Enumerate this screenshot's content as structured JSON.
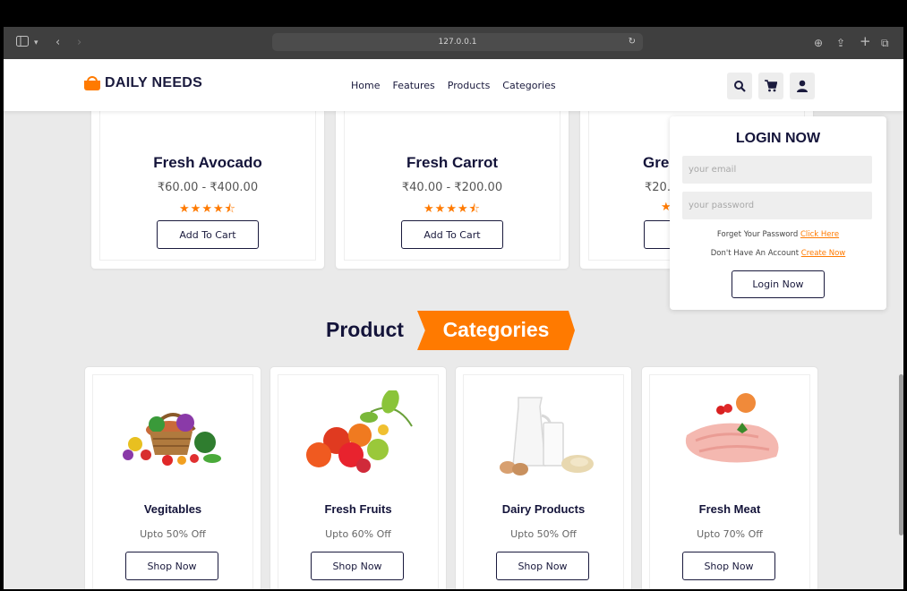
{
  "browser": {
    "url": "127.0.0.1",
    "icons": [
      "sidebar-icon",
      "chevron-down-icon",
      "back-icon",
      "forward-icon",
      "reload-icon",
      "download-icon",
      "share-icon",
      "new-tab-icon",
      "tabs-icon"
    ]
  },
  "header": {
    "logo_text": "DAILY NEEDS",
    "nav": [
      "Home",
      "Features",
      "Products",
      "Categories"
    ],
    "icons": [
      "search-icon",
      "cart-icon",
      "user-icon"
    ]
  },
  "products": [
    {
      "name": "Fresh Avocado",
      "price": "₹60.00 - ₹400.00",
      "rating": 4.5,
      "stars": "★★★★⯪",
      "button": "Add To Cart"
    },
    {
      "name": "Fresh Carrot",
      "price": "₹40.00 - ₹200.00",
      "rating": 4.5,
      "stars": "★★★★⯪",
      "button": "Add To Cart"
    },
    {
      "name": "Gre",
      "price": "₹20.0",
      "stars": "★",
      "button": "A"
    }
  ],
  "section": {
    "title_a": "Product",
    "title_b": "Categories"
  },
  "categories": [
    {
      "name": "Vegitables",
      "offer": "Upto 50% Off",
      "button": "Shop Now"
    },
    {
      "name": "Fresh Fruits",
      "offer": "Upto 60% Off",
      "button": "Shop Now"
    },
    {
      "name": "Dairy Products",
      "offer": "Upto 50% Off",
      "button": "Shop Now"
    },
    {
      "name": "Fresh Meat",
      "offer": "Upto 70% Off",
      "button": "Shop Now"
    }
  ],
  "login": {
    "title": "LOGIN NOW",
    "email_placeholder": "your email",
    "password_placeholder": "your password",
    "forgot_text": "Forget Your Password",
    "forgot_link": "Click Here",
    "account_text": "Don't Have An Account",
    "account_link": "Create Now",
    "button": "Login Now"
  },
  "colors": {
    "accent": "#ff7a00",
    "navy": "#1a1a3d",
    "page_bg": "#eaeaea"
  }
}
